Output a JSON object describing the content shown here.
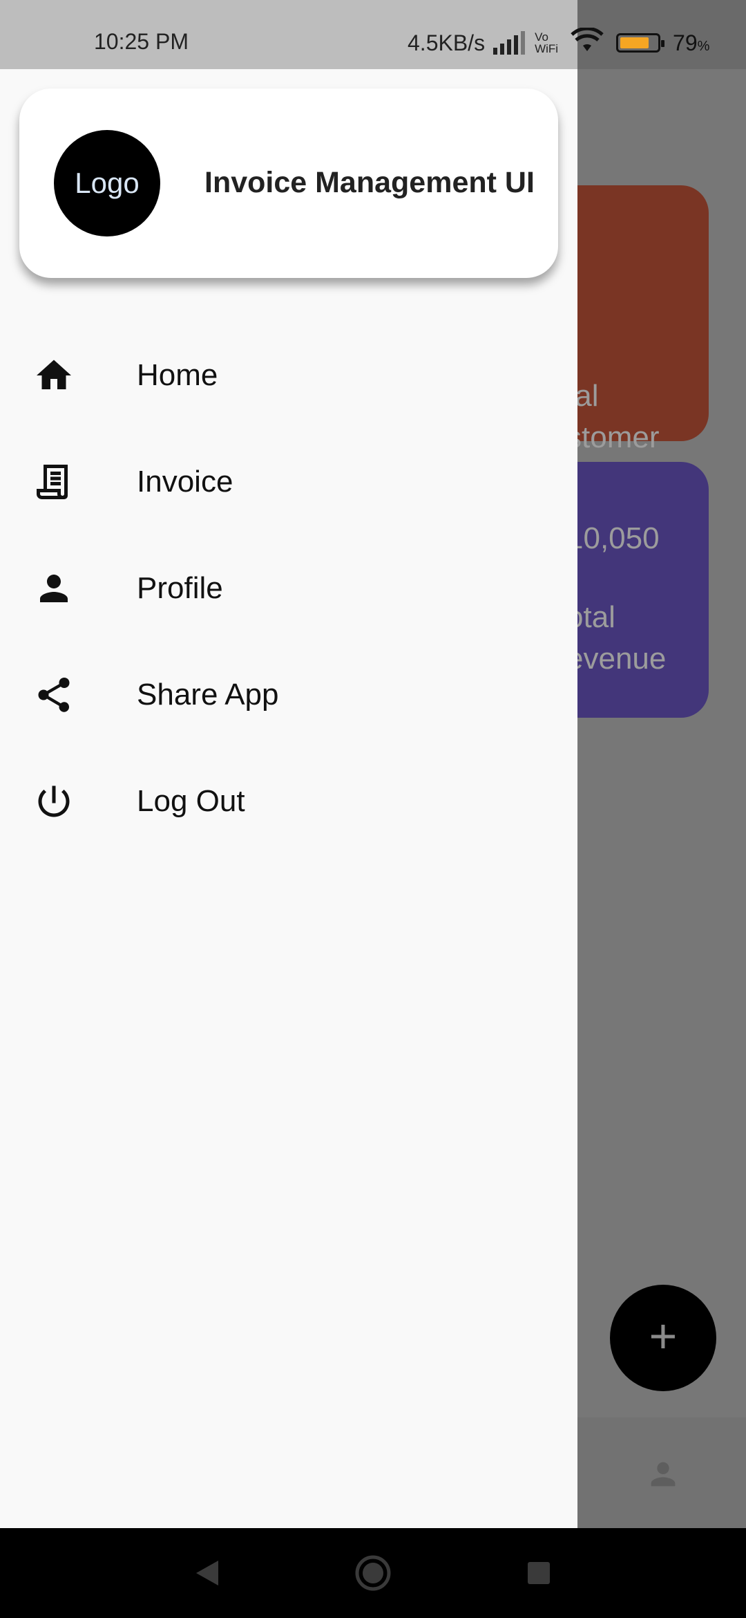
{
  "status_bar": {
    "time": "10:25 PM",
    "net_speed": "4.5KB/s",
    "vowifi_top": "Vo",
    "vowifi_bottom": "WiFi",
    "battery_level": 0.79,
    "battery_pct": "79",
    "battery_pct_suffix": "%",
    "colors": {
      "battery": "#f5a623"
    }
  },
  "drawer": {
    "logo_text": "Logo",
    "app_title": "Invoice Management UI",
    "items": [
      {
        "label": "Home",
        "icon": "home-icon"
      },
      {
        "label": "Invoice",
        "icon": "receipt-icon"
      },
      {
        "label": "Profile",
        "icon": "person-icon"
      },
      {
        "label": "Share App",
        "icon": "share-icon"
      },
      {
        "label": "Log Out",
        "icon": "power-icon"
      }
    ]
  },
  "background": {
    "card_customer": {
      "line1": "tal",
      "line2": "stomer",
      "color": "#7a3524"
    },
    "card_revenue": {
      "value": "10,050",
      "line1": "otal",
      "line2": "evenue",
      "color": "#43367a"
    },
    "fab_label": "+"
  },
  "nav_bar": {
    "back": "back-icon",
    "home": "home-circle-icon",
    "recents": "recents-icon"
  }
}
